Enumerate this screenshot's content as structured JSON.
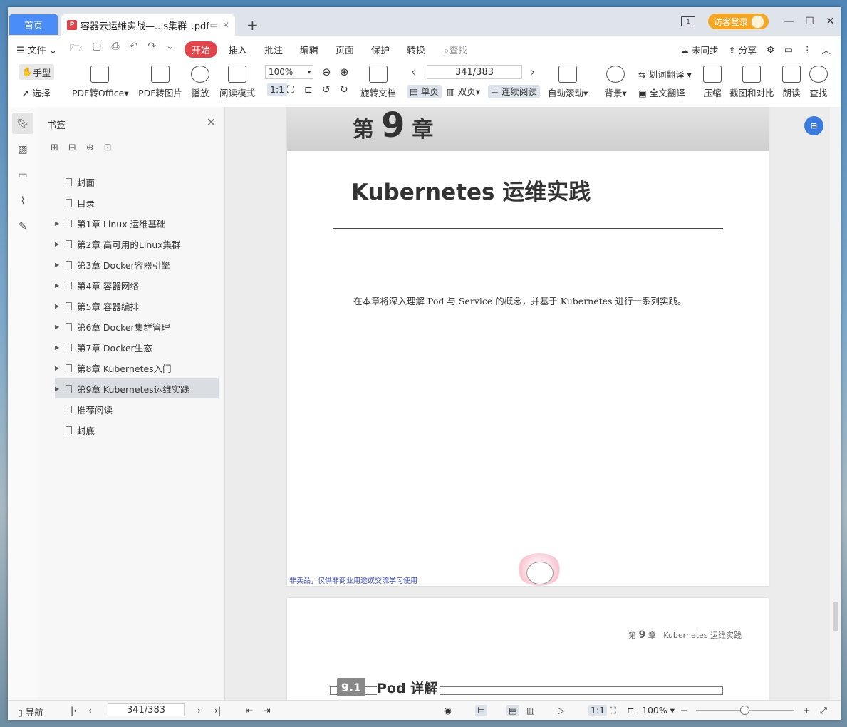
{
  "tabs": {
    "home": "首页",
    "doc": "容器云运维实战—...s集群_.pdf",
    "new_tab": "+"
  },
  "titlebar": {
    "panel": "1",
    "login": "访客登录",
    "minimize": "—",
    "maximize": "☐",
    "close": "✕"
  },
  "menu": {
    "file": "文件",
    "start": "开始",
    "items": [
      "插入",
      "批注",
      "编辑",
      "页面",
      "保护",
      "转换"
    ],
    "search": "查找",
    "sync": "未同步",
    "share": "分享"
  },
  "ribbon": {
    "hand": "手型",
    "select": "选择",
    "pdf_office": "PDF转Office",
    "pdf_image": "PDF转图片",
    "play": "播放",
    "reading_mode": "阅读模式",
    "zoom": "100%",
    "rotate": "旋转文档",
    "page_input": "341/383",
    "single": "单页",
    "double": "双页",
    "continuous": "连续阅读",
    "auto_scroll": "自动滚动",
    "background": "背景",
    "word_translate": "划词翻译",
    "full_translate": "全文翻译",
    "compress": "压缩",
    "compare": "截图和对比",
    "read_aloud": "朗读",
    "find": "查找"
  },
  "sidebar": {
    "title": "书签",
    "bookmarks": [
      {
        "label": "封面",
        "expandable": false
      },
      {
        "label": "目录",
        "expandable": false
      },
      {
        "label": "第1章 Linux 运维基础",
        "expandable": true
      },
      {
        "label": "第2章 高可用的Linux集群",
        "expandable": true
      },
      {
        "label": "第3章 Docker容器引擎",
        "expandable": true
      },
      {
        "label": "第4章 容器网络",
        "expandable": true
      },
      {
        "label": "第5章 容器编排",
        "expandable": true
      },
      {
        "label": "第6章 Docker集群管理",
        "expandable": true
      },
      {
        "label": "第7章 Docker生态",
        "expandable": true
      },
      {
        "label": "第8章 Kubernetes入门",
        "expandable": true
      },
      {
        "label": "第9章 Kubernetes运维实践",
        "expandable": true,
        "active": true
      },
      {
        "label": "推荐阅读",
        "expandable": false
      },
      {
        "label": "封底",
        "expandable": false
      }
    ]
  },
  "page1": {
    "chapter_prefix": "第",
    "chapter_num": "9",
    "chapter_suffix": "章",
    "title": "Kubernetes 运维实践",
    "intro": "在本章将深入理解 Pod 与 Service 的概念，并基于 Kubernetes 进行一系列实践。",
    "footer": "非卖品，仅供非商业用途或交流学习使用"
  },
  "page2": {
    "header_prefix": "第",
    "header_num": "9",
    "header_suffix": "章",
    "header_title": "Kubernetes 运维实践",
    "section_num": "9.1",
    "section_title": "Pod 详解"
  },
  "status": {
    "nav": "导航",
    "page": "341/383",
    "zoom": "100%"
  }
}
